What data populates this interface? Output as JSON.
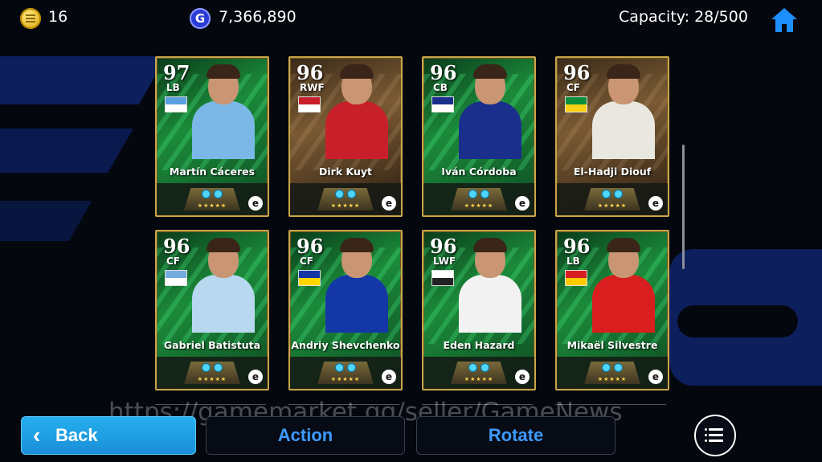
{
  "top": {
    "coins": "16",
    "gp": "7,366,890",
    "gp_symbol": "G",
    "capacity": "Capacity: 28/500"
  },
  "cards": [
    {
      "rating": "97",
      "position": "LB",
      "name": "Martín Cáceres",
      "style": "green",
      "kit": "#7bb8e8",
      "badge_colors": [
        "#5aa0e0",
        "#ffffff"
      ],
      "stars": "★★★★★"
    },
    {
      "rating": "96",
      "position": "RWF",
      "name": "Dirk Kuyt",
      "style": "sepia",
      "kit": "#c8202a",
      "badge_colors": [
        "#c8202a",
        "#ffffff"
      ],
      "stars": "★★★★★"
    },
    {
      "rating": "96",
      "position": "CB",
      "name": "Iván Córdoba",
      "style": "green",
      "kit": "#1a2f8c",
      "badge_colors": [
        "#1a2f8c",
        "#ffffff"
      ],
      "stars": "★★★★★"
    },
    {
      "rating": "96",
      "position": "CF",
      "name": "El-Hadji Diouf",
      "style": "sepia",
      "kit": "#e8e8e0",
      "badge_colors": [
        "#0a8f3a",
        "#fcd116"
      ],
      "stars": "★★★★★"
    },
    {
      "rating": "96",
      "position": "CF",
      "name": "Gabriel Batistuta",
      "style": "green",
      "kit": "#b8d8f0",
      "badge_colors": [
        "#74acdf",
        "#ffffff"
      ],
      "stars": "★★★★★"
    },
    {
      "rating": "96",
      "position": "CF",
      "name": "Andriy Shevchenko",
      "style": "green",
      "kit": "#1437a8",
      "badge_colors": [
        "#1437a8",
        "#ffd700"
      ],
      "stars": "★★★★★"
    },
    {
      "rating": "96",
      "position": "LWF",
      "name": "Eden Hazard",
      "style": "green",
      "kit": "#f2f2f2",
      "badge_colors": [
        "#ffffff",
        "#222222"
      ],
      "stars": "★★★★★"
    },
    {
      "rating": "96",
      "position": "LB",
      "name": "Mikaël Silvestre",
      "style": "green",
      "kit": "#d81e1e",
      "badge_colors": [
        "#d81e1e",
        "#ffcc00"
      ],
      "stars": "★★★★★"
    }
  ],
  "card_logo": "e",
  "watermark": "https://gamemarket.gg/seller/GameNews",
  "buttons": {
    "back": "Back",
    "action": "Action",
    "rotate": "Rotate"
  },
  "icons": {
    "coin": "coin-icon",
    "gp": "gp-icon",
    "home": "home-icon",
    "menu": "menu-list-icon",
    "back": "chevron-left-icon"
  },
  "colors": {
    "accent_blue": "#1a8fd8",
    "button_text": "#3d9bff",
    "card_border": "#c9a64a"
  }
}
